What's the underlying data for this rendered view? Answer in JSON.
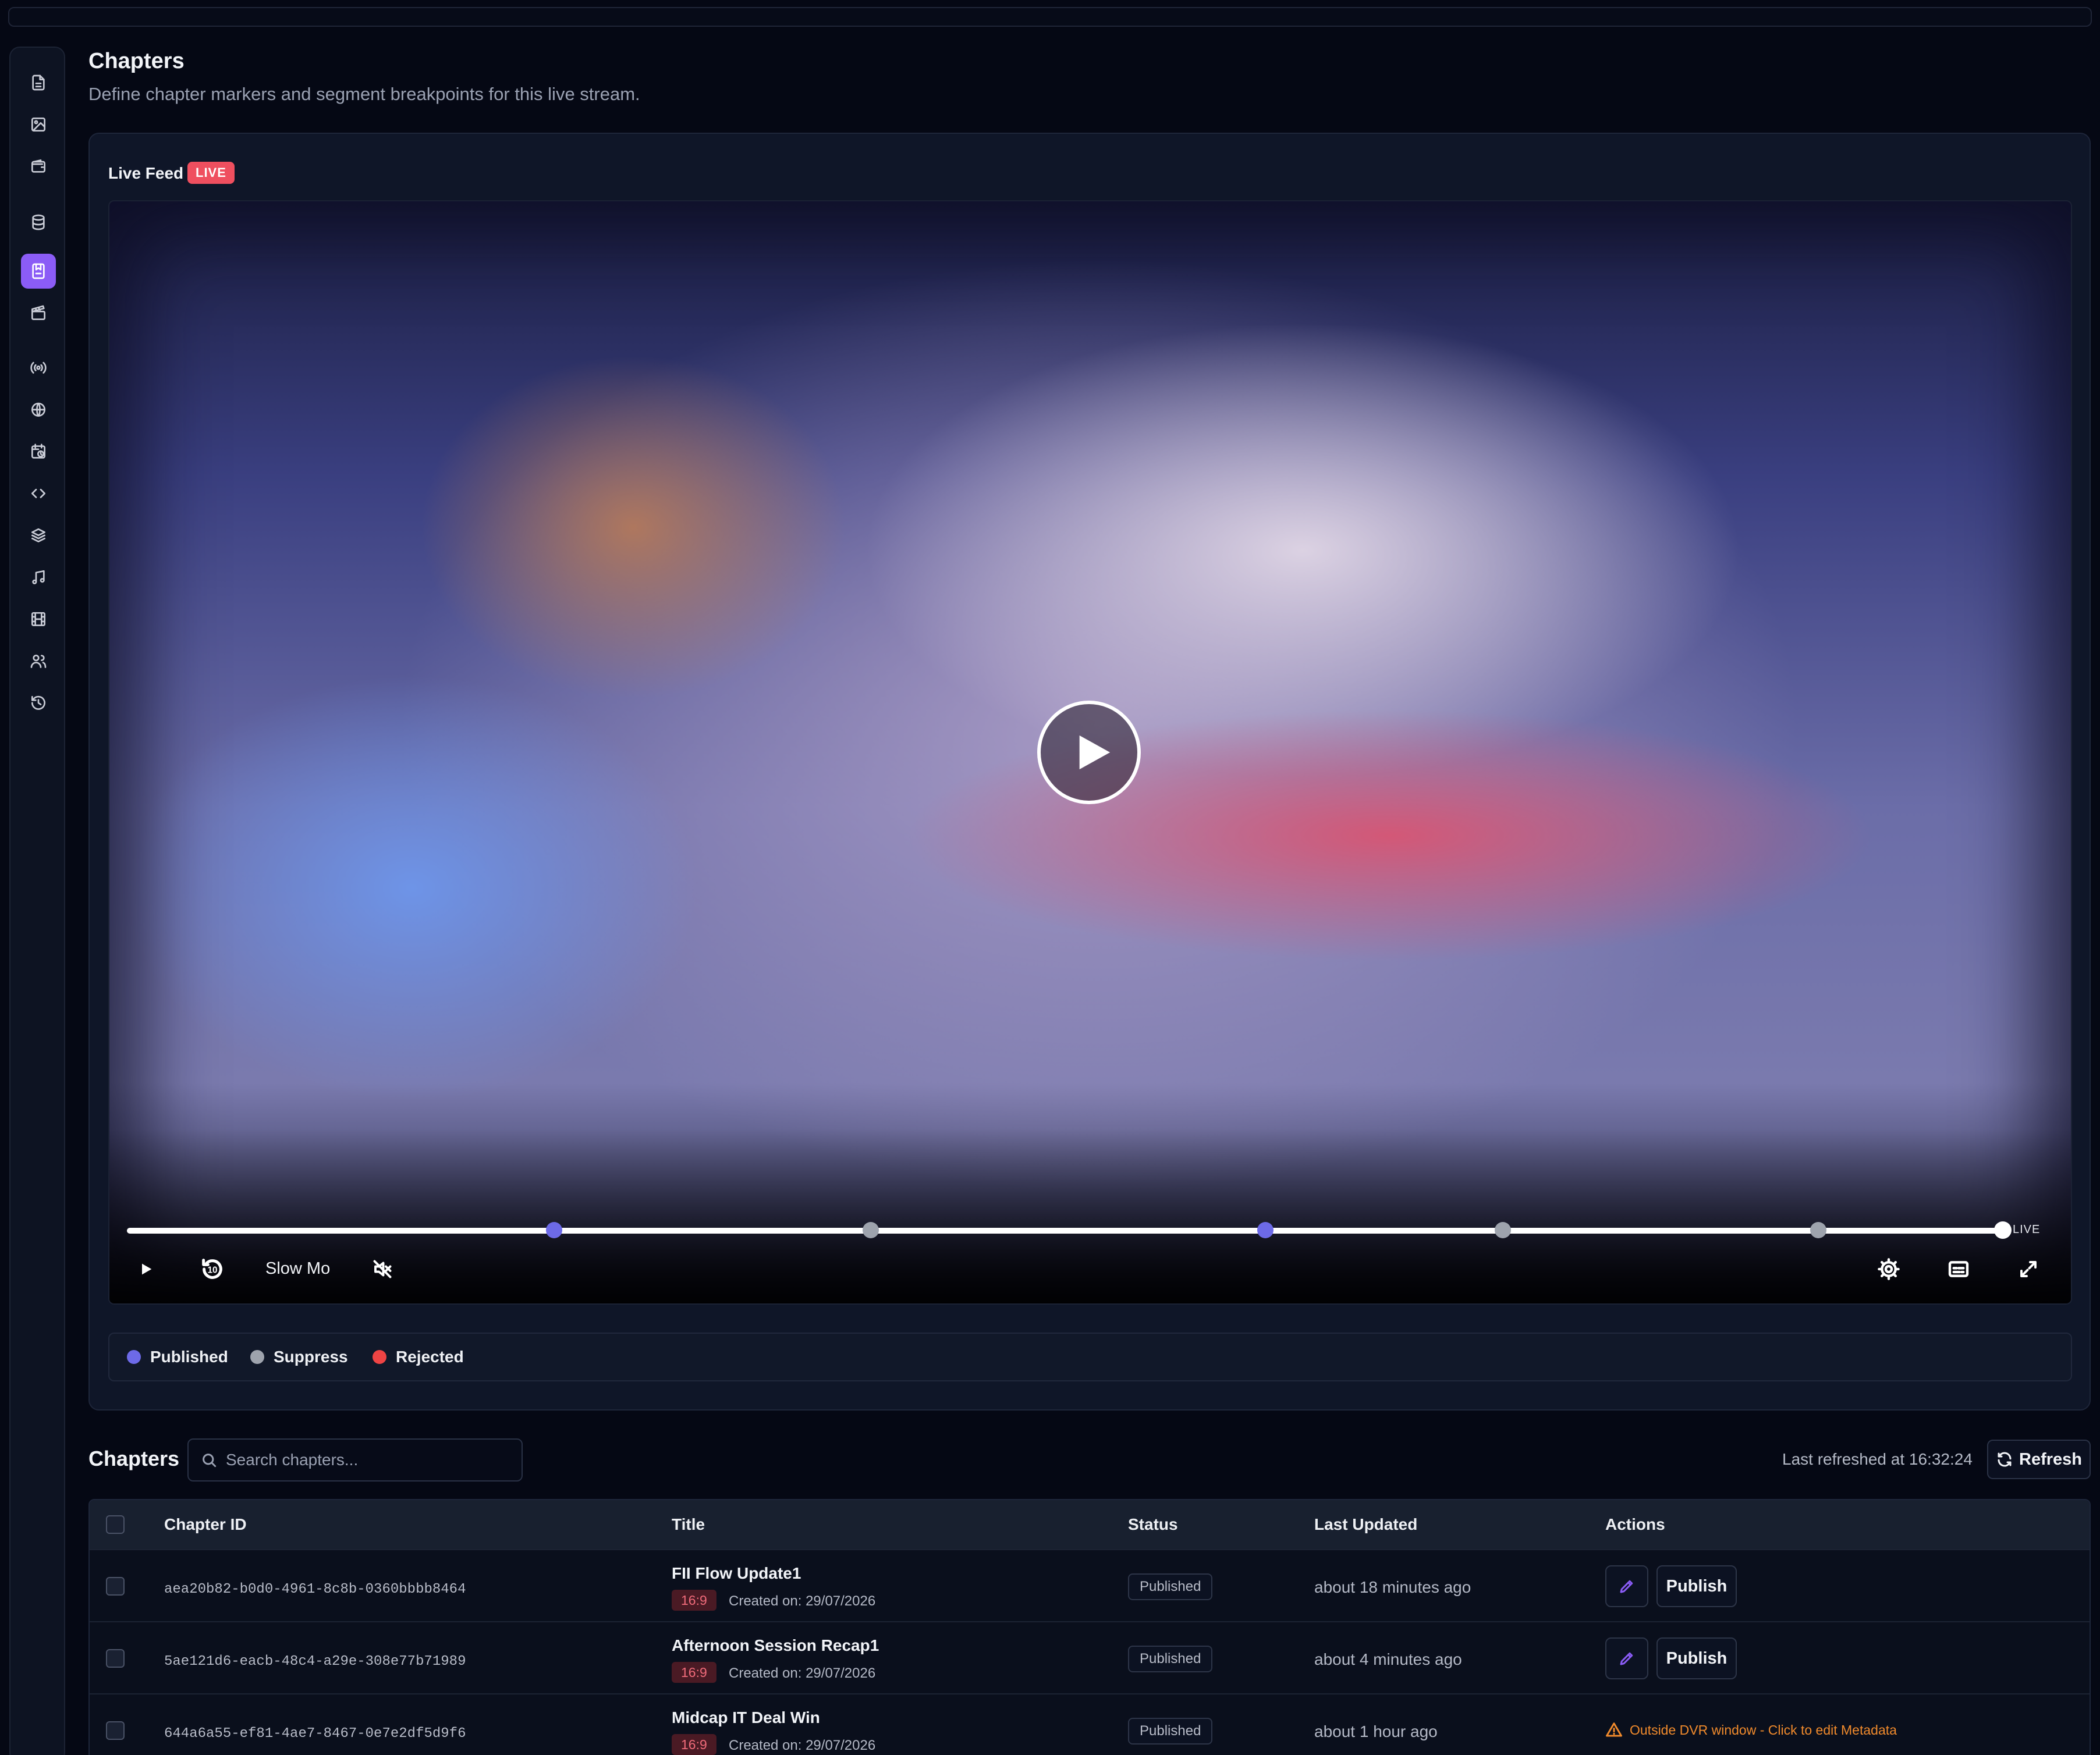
{
  "header": {
    "title": "Chapters",
    "subtitle": "Define chapter markers and segment breakpoints for this live stream."
  },
  "sidebar": {
    "items": [
      {
        "icon": "document-icon"
      },
      {
        "icon": "image-icon"
      },
      {
        "icon": "wallet-icon"
      },
      {
        "icon": "database-icon"
      },
      {
        "icon": "chapters-icon",
        "active": true
      },
      {
        "icon": "clapperboard-icon"
      },
      {
        "icon": "broadcast-icon"
      },
      {
        "icon": "globe-icon"
      },
      {
        "icon": "calendar-clock-icon"
      },
      {
        "icon": "code-icon"
      },
      {
        "icon": "layers-icon"
      },
      {
        "icon": "music-icon"
      },
      {
        "icon": "film-icon"
      },
      {
        "icon": "users-icon"
      },
      {
        "icon": "history-icon"
      }
    ]
  },
  "player": {
    "label": "Live Feed",
    "badge": "LIVE",
    "live_label": "LIVE",
    "slow_mo_label": "Slow Mo",
    "rewind_seconds": "10",
    "markers": [
      {
        "status": "published"
      },
      {
        "status": "suppress"
      },
      {
        "status": "published"
      },
      {
        "status": "suppress"
      },
      {
        "status": "suppress"
      }
    ],
    "colors": {
      "published": "#6d6ae8",
      "suppress": "#9ea3ad",
      "rejected": "#ef4444",
      "live_badge": "#ef4f5f"
    }
  },
  "legend": {
    "items": [
      {
        "label": "Published",
        "color": "#6d6ae8"
      },
      {
        "label": "Suppress",
        "color": "#9ea3ad"
      },
      {
        "label": "Rejected",
        "color": "#ef4444"
      }
    ]
  },
  "chapters": {
    "heading": "Chapters",
    "search_placeholder": "Search chapters...",
    "last_refreshed": "Last refreshed at 16:32:24",
    "refresh_label": "Refresh",
    "columns": {
      "id": "Chapter ID",
      "title": "Title",
      "status": "Status",
      "updated": "Last Updated",
      "actions": "Actions"
    },
    "rows": [
      {
        "id": "aea20b82-b0d0-4961-8c8b-0360bbbb8464",
        "title": "FII Flow Update1",
        "ratio": "16:9",
        "created": "Created on: 29/07/2026",
        "status": "Published",
        "updated": "about 18 minutes ago",
        "action": "Publish"
      },
      {
        "id": "5ae121d6-eacb-48c4-a29e-308e77b71989",
        "title": "Afternoon Session Recap1",
        "ratio": "16:9",
        "created": "Created on: 29/07/2026",
        "status": "Published",
        "updated": "about 4 minutes ago",
        "action": "Publish"
      },
      {
        "id": "644a6a55-ef81-4ae7-8467-0e7e2df5d9f6",
        "title": "Midcap IT Deal Win",
        "ratio": "16:9",
        "created": "Created on: 29/07/2026",
        "status": "Published",
        "updated": "about 1 hour ago",
        "warning": "Outside DVR window - Click to edit Metadata"
      }
    ]
  }
}
